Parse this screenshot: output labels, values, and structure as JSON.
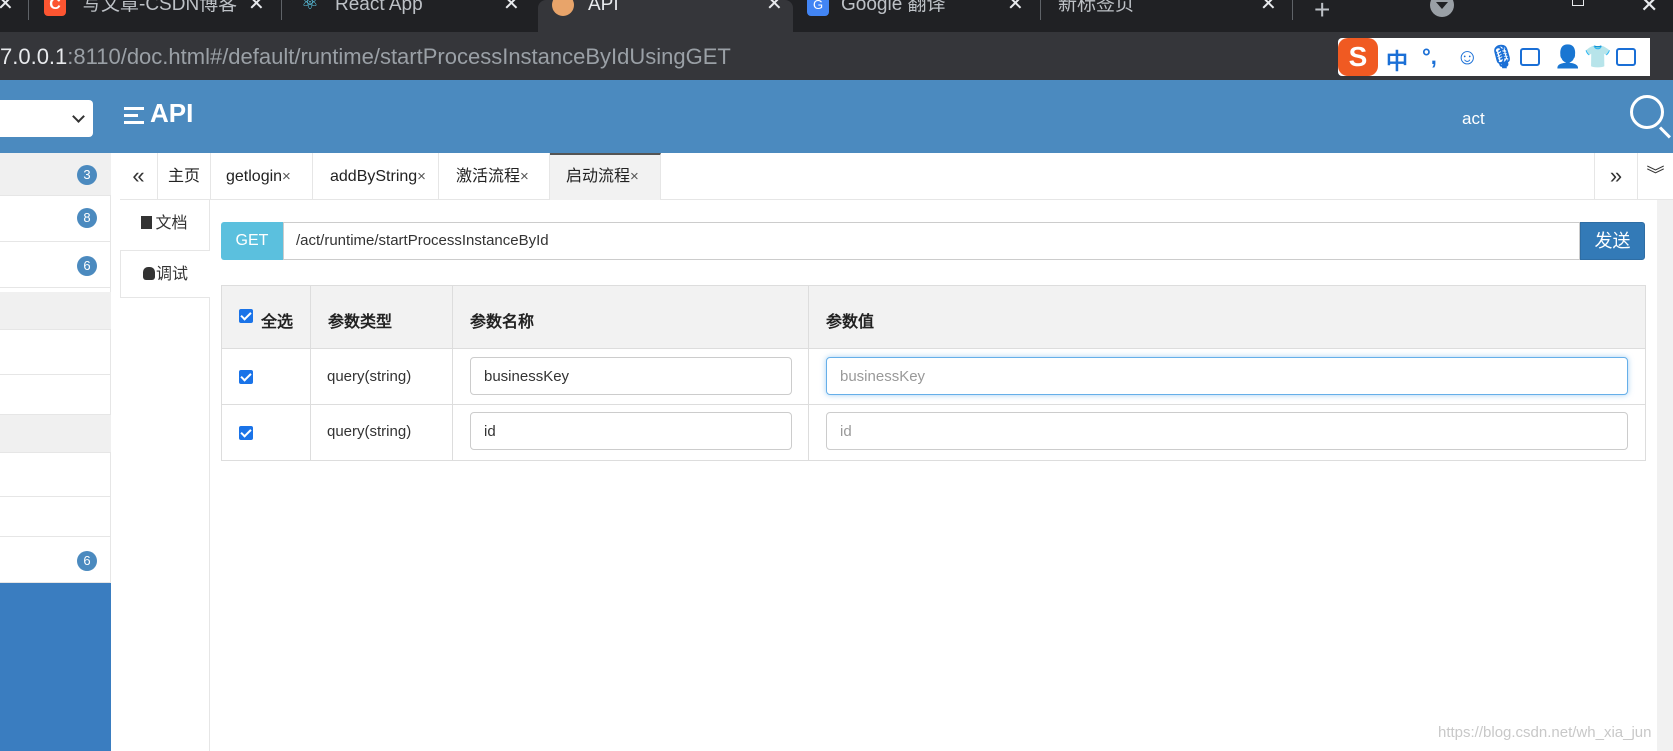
{
  "browser": {
    "tabs": [
      {
        "title": "写文章-CSDN博客",
        "icon": "csdn-icon",
        "color": "#fc5531"
      },
      {
        "title": "React App",
        "icon": "react-icon",
        "color": "#61dafb"
      },
      {
        "title": "API",
        "icon": "doc-favicon",
        "color": "#e8a46a"
      },
      {
        "title": "Google 翻译",
        "icon": "google-translate-icon",
        "color": "#4285f4"
      },
      {
        "title": "新标签页",
        "icon": "",
        "color": ""
      }
    ],
    "url_host": "7.0.0.1",
    "url_path": ":8110/doc.html#/default/runtime/startProcessInstanceByIdUsingGET",
    "ime": {
      "logo": "S",
      "mode": "中",
      "punct": "°,"
    }
  },
  "header": {
    "title": "API",
    "search_text": "act",
    "bg_color": "#4b8abf"
  },
  "sidebar": {
    "badges": [
      "3",
      "8",
      "6",
      "6"
    ]
  },
  "doc_tabs": [
    {
      "label": "主页",
      "closable": false
    },
    {
      "label": "getlogin",
      "closable": true
    },
    {
      "label": "addByString",
      "closable": true
    },
    {
      "label": "激活流程",
      "closable": true
    },
    {
      "label": "启动流程",
      "closable": true
    }
  ],
  "tab_close": "×",
  "tab_nav": {
    "left": "«",
    "right": "»",
    "more": "︾"
  },
  "side_tabs": {
    "doc": "文档",
    "debug": "调试"
  },
  "request": {
    "method": "GET",
    "path": "/act/runtime/startProcessInstanceById",
    "send_label": "发送",
    "method_color": "#5bc0de",
    "send_color": "#337ab7"
  },
  "params_table": {
    "headers": {
      "select_all": "全选",
      "type": "参数类型",
      "name": "参数名称",
      "value": "参数值"
    },
    "rows": [
      {
        "checked": true,
        "type": "query(string)",
        "name": "businessKey",
        "value_placeholder": "businessKey"
      },
      {
        "checked": true,
        "type": "query(string)",
        "name": "id",
        "value_placeholder": "id"
      }
    ]
  },
  "watermark": "https://blog.csdn.net/wh_xia_jun"
}
